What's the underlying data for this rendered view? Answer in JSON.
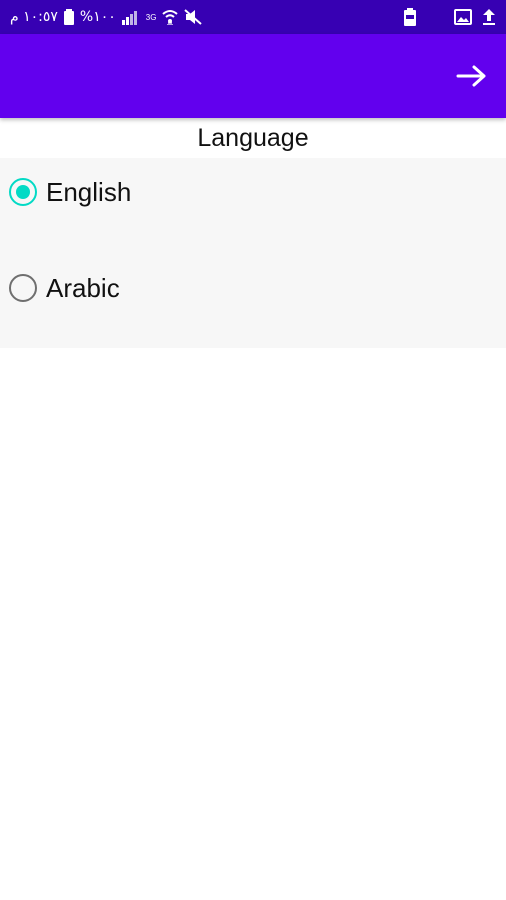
{
  "status_bar": {
    "time": "١٠:٥٧ م",
    "battery_percent": "%١٠٠",
    "network_type": "3G",
    "colors": {
      "background": "#3700b3",
      "foreground": "#ffffff"
    }
  },
  "app_bar": {
    "back_icon": "arrow-right-icon",
    "colors": {
      "background": "#6200ee"
    }
  },
  "page": {
    "title": "Language"
  },
  "language_options": [
    {
      "label": "English",
      "selected": true
    },
    {
      "label": "Arabic",
      "selected": false
    }
  ],
  "colors": {
    "accent": "#03dac5",
    "radio_unchecked": "#6f6f6f",
    "options_background": "#f7f7f7"
  }
}
